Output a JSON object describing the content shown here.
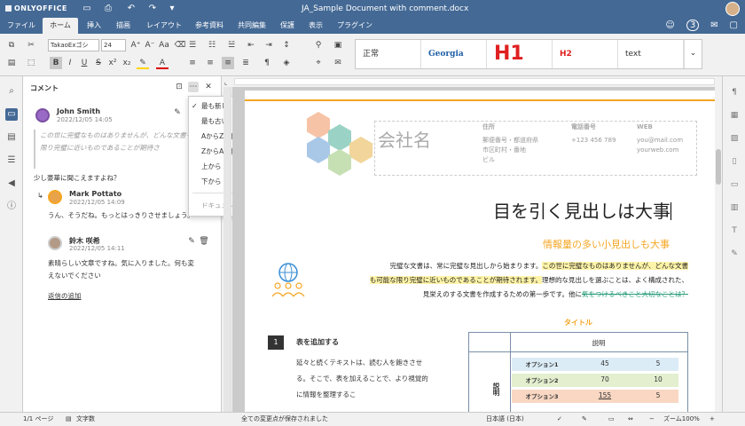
{
  "app": {
    "brand": "ONLYOFFICE",
    "doc_title": "JA_Sample Document with comment.docx",
    "users_count": "3"
  },
  "tabs": [
    {
      "label": "ファイル"
    },
    {
      "label": "ホーム"
    },
    {
      "label": "挿入"
    },
    {
      "label": "描画"
    },
    {
      "label": "レイアウト"
    },
    {
      "label": "参考資料"
    },
    {
      "label": "共同編集"
    },
    {
      "label": "保護"
    },
    {
      "label": "表示"
    },
    {
      "label": "プラグイン"
    }
  ],
  "toolbar": {
    "font_name": "TakaoExゴシ",
    "font_size": "24"
  },
  "styles": [
    {
      "label": "正常",
      "color": "#000000"
    },
    {
      "label": "Georgia",
      "color": "#1f5fa6"
    },
    {
      "label": "H1",
      "color": "#e02020"
    },
    {
      "label": "H2",
      "color": "#e02020"
    },
    {
      "label": "text",
      "color": "#333333"
    }
  ],
  "panel": {
    "title": "コメント"
  },
  "comments": [
    {
      "author": "John Smith",
      "date": "2022/12/05 14:05",
      "quote": "この世に完璧なものはありませんが、どんな文書も可能な限り完璧に近いものであることが期待さ",
      "text": "少し豪華に聞こえますよね？"
    },
    {
      "author": "Mark Pottato",
      "date": "2022/12/05 14:09",
      "text": "うん、そうだね。もっとはっきりさせましょう。"
    },
    {
      "author": "鈴木 咲希",
      "date": "2022/12/05 14:11",
      "text_line1": "素晴らしい文章ですね。気に入りました。何も変",
      "text_line2": "えないでください"
    }
  ],
  "add_reply": "返信の追加",
  "sort_menu": {
    "items": [
      {
        "label": "最も新しい",
        "checked": true
      },
      {
        "label": "最も古い"
      },
      {
        "label": "AからZで作成者を表示する"
      },
      {
        "label": "ZからAで作成者を表示する"
      },
      {
        "label": "上から"
      },
      {
        "label": "下から"
      }
    ],
    "add_doc_comment": "ドキュメントにコメントの追加"
  },
  "document": {
    "company": "会社名",
    "address_label": "住所",
    "address_lines": [
      "郵便番号・都道府県",
      "市区町村・番地",
      "ビル"
    ],
    "phone_label": "電話番号",
    "phone": "+123 456 789",
    "web_label": "WEB",
    "web_lines": [
      "you@mail.com",
      "yourweb.com"
    ],
    "heading": "目を引く見出しは大事",
    "subheading": "情報量の多い小見出しも大事",
    "para_line1_a": "完璧な文書は、常に完璧な見出しから始まります。",
    "para_line1_b": "この世に完璧なものはありませんが、どんな文書",
    "para_line2_a": "も可能な限り完璧に近いものであることが期待されます。",
    "para_line2_b": "理想的な見出しを選ぶことは、よく構成された、",
    "para_line3_a": "見栄えのする文書を作成するための第一歩です。他に",
    "para_line3_b": "気をつけるべきこと大切なことは？",
    "section_number": "1",
    "section_title": "表を追加する",
    "section_body": "延々と続くテキストは、読む人を飽きさせる。そこで、表を加えることで、より視覚的に情報を整理するこ",
    "table_title": "タイトル",
    "table_header": "説明",
    "table_row_label": "説明",
    "table_rows": [
      {
        "label": "オプション1",
        "v1": "45",
        "v2": "5"
      },
      {
        "label": "オプション2",
        "v1": "70",
        "v2": "10"
      },
      {
        "label": "オプション3",
        "v1": "155",
        "v2": "5"
      }
    ]
  },
  "status": {
    "page": "1/1 ページ",
    "word_count": "文字数",
    "saved": "全ての変更点が保存されました",
    "language": "日本語 (日本)",
    "zoom": "ズーム100%"
  }
}
